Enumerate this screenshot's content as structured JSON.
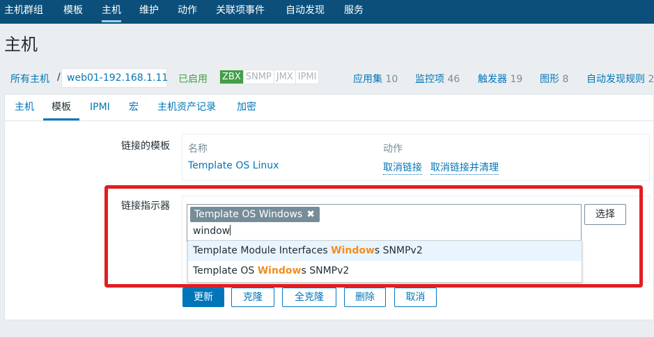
{
  "topnav": {
    "items": [
      {
        "label": "主机群组",
        "active": false
      },
      {
        "label": "模板",
        "active": false
      },
      {
        "label": "主机",
        "active": true
      },
      {
        "label": "维护",
        "active": false
      },
      {
        "label": "动作",
        "active": false
      },
      {
        "label": "关联项事件",
        "active": false
      },
      {
        "label": "自动发现",
        "active": false
      },
      {
        "label": "服务",
        "active": false
      }
    ]
  },
  "page": {
    "title": "主机"
  },
  "breadcrumb": {
    "all_hosts": "所有主机",
    "separator": "/",
    "current_host": "web01-192.168.1.11",
    "status": "已启用",
    "availability": [
      "ZBX",
      "SNMP",
      "JMX",
      "IPMI"
    ],
    "links": [
      {
        "label": "应用集",
        "count": "10"
      },
      {
        "label": "监控项",
        "count": "46"
      },
      {
        "label": "触发器",
        "count": "19"
      },
      {
        "label": "图形",
        "count": "8"
      },
      {
        "label": "自动发现规则",
        "count": "2"
      }
    ]
  },
  "tabs": [
    "主机",
    "模板",
    "IPMI",
    "宏",
    "主机资产记录",
    "加密"
  ],
  "active_tab": "模板",
  "form": {
    "linked_templates_label": "链接的模板",
    "linked_table": {
      "col_name": "名称",
      "col_action": "动作",
      "rows": [
        {
          "name": "Template OS Linux",
          "unlink": "取消链接",
          "unlink_clear": "取消链接并清理"
        }
      ]
    },
    "link_new_label": "链接指示器",
    "selected_chip": "Template OS Windows",
    "chip_remove": "✖",
    "search_value": "window",
    "select_button": "选择",
    "suggestions": [
      {
        "before": "Template Module Interfaces ",
        "match": "Window",
        "after": "s SNMPv2",
        "highlighted": true
      },
      {
        "before": "Template OS ",
        "match": "Window",
        "after": "s SNMPv2",
        "highlighted": false
      }
    ]
  },
  "buttons": {
    "update": "更新",
    "clone": "克隆",
    "full_clone": "全克隆",
    "delete": "删除",
    "cancel": "取消"
  },
  "colors": {
    "topnav_bg": "#0b4f7a",
    "link": "#0275b8",
    "enabled_green": "#429e47",
    "match_orange": "#f48d1c",
    "highlight_red": "#e11d21"
  }
}
